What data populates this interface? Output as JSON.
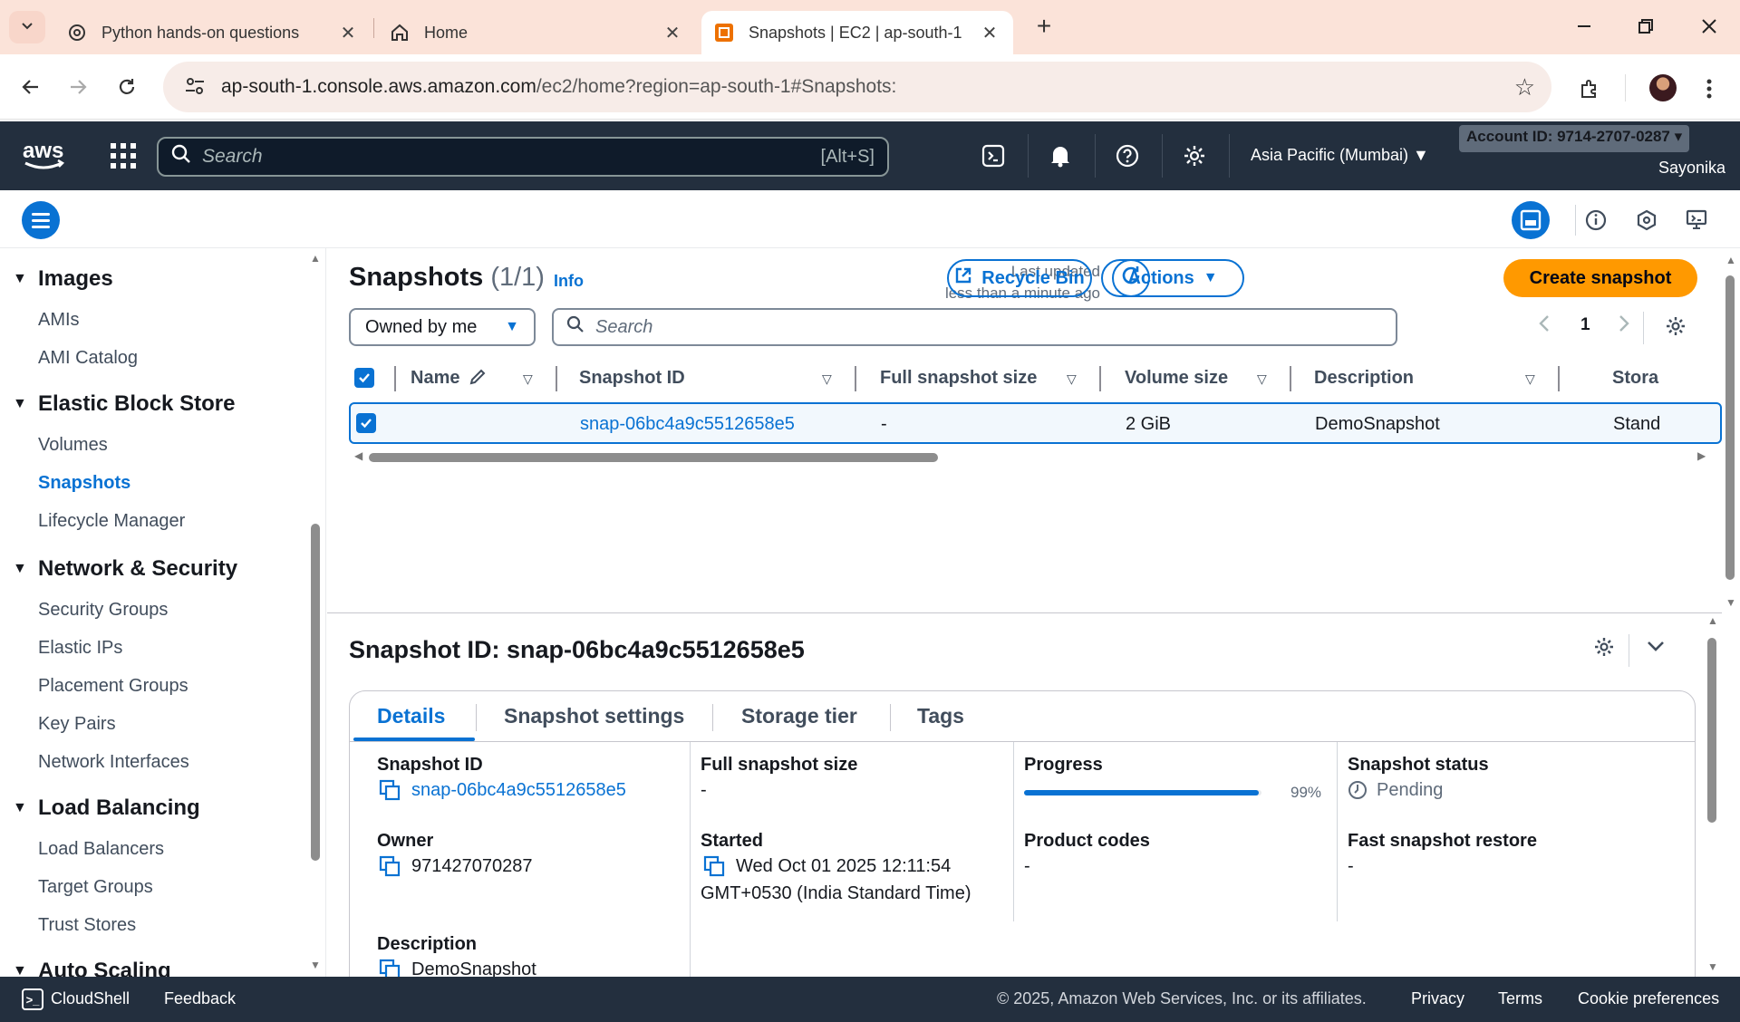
{
  "browser": {
    "tabs": [
      {
        "title": "Python hands-on questions",
        "icon": "chatgpt-icon"
      },
      {
        "title": "Home",
        "icon": "home-icon"
      },
      {
        "title": "Snapshots | EC2 | ap-south-1",
        "icon": "aws-ec2-icon",
        "active": true
      }
    ],
    "url_host": "ap-south-1.console.aws.amazon.com",
    "url_path": "/ec2/home?region=ap-south-1#Snapshots:"
  },
  "aws_nav": {
    "search_placeholder": "Search",
    "search_shortcut": "[Alt+S]",
    "region": "Asia Pacific (Mumbai) ▼",
    "account": "Account ID: 9714-2707-0287 ▾",
    "user": "Sayonika"
  },
  "sidebar": {
    "sections": [
      {
        "title": "Images",
        "items": [
          "AMIs",
          "AMI Catalog"
        ]
      },
      {
        "title": "Elastic Block Store",
        "items": [
          "Volumes",
          "Snapshots",
          "Lifecycle Manager"
        ]
      },
      {
        "title": "Network & Security",
        "items": [
          "Security Groups",
          "Elastic IPs",
          "Placement Groups",
          "Key Pairs",
          "Network Interfaces"
        ]
      },
      {
        "title": "Load Balancing",
        "items": [
          "Load Balancers",
          "Target Groups",
          "Trust Stores"
        ]
      },
      {
        "title": "Auto Scaling",
        "items": []
      }
    ],
    "active_item": "Snapshots"
  },
  "snapshots": {
    "title": "Snapshots",
    "count": "(1/1)",
    "info": "Info",
    "last_updated_line1": "Last updated",
    "last_updated_line2": "less than a minute ago",
    "recycle_bin": "Recycle Bin",
    "actions": "Actions",
    "create": "Create snapshot",
    "filter": "Owned by me",
    "search_placeholder": "Search",
    "page": "1",
    "columns": [
      "Name",
      "Snapshot ID",
      "Full snapshot size",
      "Volume size",
      "Description",
      "Stora"
    ],
    "rows": [
      {
        "name": "",
        "snapshot_id": "snap-06bc4a9c5512658e5",
        "full_size": "-",
        "volume_size": "2 GiB",
        "description": "DemoSnapshot",
        "storage": "Stand"
      }
    ]
  },
  "detail": {
    "title": "Snapshot ID: snap-06bc4a9c5512658e5",
    "tabs": [
      "Details",
      "Snapshot settings",
      "Storage tier",
      "Tags"
    ],
    "fields": {
      "snapshot_id_label": "Snapshot ID",
      "snapshot_id": "snap-06bc4a9c5512658e5",
      "owner_label": "Owner",
      "owner": "971427070287",
      "description_label": "Description",
      "description": "DemoSnapshot",
      "full_size_label": "Full snapshot size",
      "full_size": "-",
      "started_label": "Started",
      "started_line1": "Wed Oct 01 2025 12:11:54",
      "started_line2": "GMT+0530 (India Standard Time)",
      "progress_label": "Progress",
      "progress_text": "99%",
      "progress_value": 0.99,
      "product_codes_label": "Product codes",
      "product_codes": "-",
      "status_label": "Snapshot status",
      "status": "Pending",
      "fsr_label": "Fast snapshot restore",
      "fsr": "-"
    }
  },
  "footer": {
    "cloudshell": "CloudShell",
    "feedback": "Feedback",
    "copyright": "© 2025, Amazon Web Services, Inc. or its affiliates.",
    "privacy": "Privacy",
    "terms": "Terms",
    "cookies": "Cookie preferences"
  },
  "colors": {
    "accent": "#0972d3",
    "primary_button": "#ff9900",
    "nav_bg": "#232f3e",
    "tabbar_bg": "#fbe3d9"
  }
}
